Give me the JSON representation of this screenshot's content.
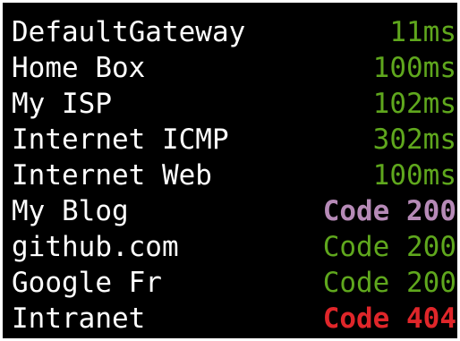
{
  "monitors": [
    {
      "name": "DefaultGateway",
      "value": "11ms",
      "color": "#5fa71d",
      "bold": false
    },
    {
      "name": "Home Box",
      "value": "100ms",
      "color": "#5fa71d",
      "bold": false
    },
    {
      "name": "My ISP",
      "value": "102ms",
      "color": "#5fa71d",
      "bold": false
    },
    {
      "name": "Internet ICMP",
      "value": "302ms",
      "color": "#5fa71d",
      "bold": false
    },
    {
      "name": "Internet Web",
      "value": "100ms",
      "color": "#5fa71d",
      "bold": false
    },
    {
      "name": "My Blog",
      "value": "Code 200",
      "color": "#b68ab7",
      "bold": true
    },
    {
      "name": "github.com",
      "value": "Code 200",
      "color": "#5fa71d",
      "bold": false
    },
    {
      "name": "Google Fr",
      "value": "Code 200",
      "color": "#5fa71d",
      "bold": false
    },
    {
      "name": "Intranet",
      "value": "Code 404",
      "color": "#e0262a",
      "bold": true
    }
  ],
  "colors": {
    "background": "#000000",
    "label": "#ffffff",
    "ok": "#5fa71d",
    "warning": "#b68ab7",
    "error": "#e0262a"
  }
}
